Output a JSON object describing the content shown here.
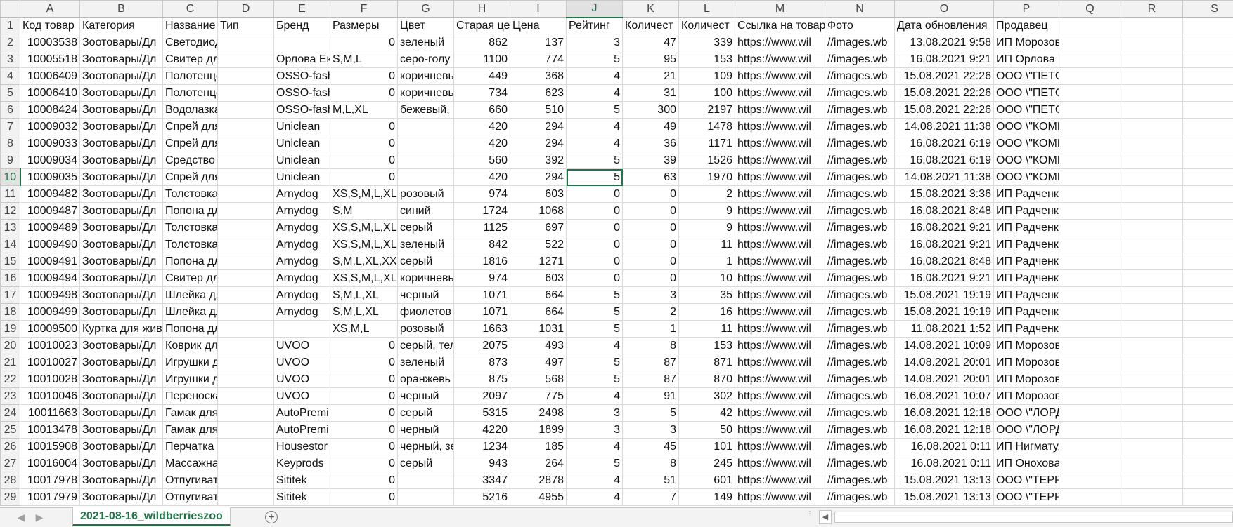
{
  "sheet": {
    "columns": [
      "A",
      "B",
      "C",
      "D",
      "E",
      "F",
      "G",
      "H",
      "I",
      "J",
      "K",
      "L",
      "M",
      "N",
      "O",
      "P",
      "Q",
      "R",
      "S"
    ],
    "headers": [
      "Код товар",
      "Категория",
      "Название",
      "Тип",
      "Бренд",
      "Размеры",
      "Цвет",
      "Старая це",
      "Цена",
      "Рейтинг",
      "Количест",
      "Количест",
      "Ссылка на товар",
      "Фото",
      "Дата обновления",
      "Продавец",
      "",
      "",
      ""
    ],
    "rows": [
      {
        "n": "2",
        "cells": [
          "10003538",
          "Зоотовары/Дл",
          "Светодиодный ошейник / Шле",
          "",
          "",
          "0",
          "зеленый",
          "862",
          "137",
          "3",
          "47",
          "339",
          "https://www.wil",
          "//images.wb",
          "13.08.2021 9:58",
          "ИП Морозов Андрей Васильевич",
          "",
          "",
          ""
        ]
      },
      {
        "n": "3",
        "cells": [
          "10005518",
          "Зоотовары/Дл",
          "Свитер для мелких п",
          "",
          "Орлова Ек",
          "S,M,L",
          "серо-голу",
          "1100",
          "774",
          "5",
          "95",
          "153",
          "https://www.wil",
          "//images.wb",
          "16.08.2021 9:21",
          "ИП Орлова Екатерина Александровна",
          "",
          "",
          ""
        ]
      },
      {
        "n": "4",
        "cells": [
          "10006409",
          "Зоотовары/Дл",
          "Полотенце для соба",
          "",
          "OSSO-fash",
          "0",
          "коричневы",
          "449",
          "368",
          "4",
          "21",
          "109",
          "https://www.wil",
          "//images.wb",
          "15.08.2021 22:26",
          "ООО \\\"ПЕТСОВЕТ\\\"",
          "",
          "",
          ""
        ]
      },
      {
        "n": "5",
        "cells": [
          "10006410",
          "Зоотовары/Дл",
          "Полотенце для живо",
          "",
          "OSSO-fash",
          "0",
          "коричневы",
          "734",
          "623",
          "4",
          "31",
          "100",
          "https://www.wil",
          "//images.wb",
          "15.08.2021 22:26",
          "ООО \\\"ПЕТСОВЕТ\\\"",
          "",
          "",
          ""
        ]
      },
      {
        "n": "6",
        "cells": [
          "10008424",
          "Зоотовары/Дл",
          "Водолазка для коше",
          "",
          "OSSO-fash",
          "M,L,XL",
          "бежевый,",
          "660",
          "510",
          "5",
          "300",
          "2197",
          "https://www.wil",
          "//images.wb",
          "15.08.2021 22:26",
          "ООО \\\"ПЕТСОВЕТ\\\"",
          "",
          "",
          ""
        ]
      },
      {
        "n": "7",
        "cells": [
          "10009032",
          "Зоотовары/Дл",
          "Спрей для удаления",
          "",
          "Uniclean",
          "0",
          "",
          "420",
          "294",
          "4",
          "49",
          "1478",
          "https://www.wil",
          "//images.wb",
          "14.08.2021 11:38",
          "ООО \\\"КОМПАНИЯ ЮНИКЛИН\\\"",
          "",
          "",
          ""
        ]
      },
      {
        "n": "8",
        "cells": [
          "10009033",
          "Зоотовары/Дл",
          "Спрей для удаления",
          "",
          "Uniclean",
          "0",
          "",
          "420",
          "294",
          "4",
          "36",
          "1171",
          "https://www.wil",
          "//images.wb",
          "16.08.2021 6:19",
          "ООО \\\"КОМПАНИЯ ЮНИКЛИН\\\"",
          "",
          "",
          ""
        ]
      },
      {
        "n": "9",
        "cells": [
          "10009034",
          "Зоотовары/Дл",
          "Средство для мытья",
          "",
          "Uniclean",
          "0",
          "",
          "560",
          "392",
          "5",
          "39",
          "1526",
          "https://www.wil",
          "//images.wb",
          "16.08.2021 6:19",
          "ООО \\\"КОМПАНИЯ ЮНИКЛИН\\\"",
          "",
          "",
          ""
        ]
      },
      {
        "n": "10",
        "cells": [
          "10009035",
          "Зоотовары/Дл",
          "Спрей для мытья ко",
          "",
          "Uniclean",
          "0",
          "",
          "420",
          "294",
          "5",
          "63",
          "1970",
          "https://www.wil",
          "//images.wb",
          "14.08.2021 11:38",
          "ООО \\\"КОМПАНИЯ ЮНИКЛИН\\\"",
          "",
          "",
          ""
        ]
      },
      {
        "n": "11",
        "cells": [
          "10009482",
          "Зоотовары/Дл",
          "Толстовка для соба",
          "",
          "Arnydog",
          "XS,S,M,L,XL",
          "розовый",
          "974",
          "603",
          "0",
          "0",
          "2",
          "https://www.wil",
          "//images.wb",
          "15.08.2021 3:36",
          "ИП Радченко Наталья Александровна",
          "",
          "",
          ""
        ]
      },
      {
        "n": "12",
        "cells": [
          "10009487",
          "Зоотовары/Дл",
          "Попона для собак \"/",
          "",
          "Arnydog",
          "S,M",
          "синий",
          "1724",
          "1068",
          "0",
          "0",
          "9",
          "https://www.wil",
          "//images.wb",
          "16.08.2021 8:48",
          "ИП Радченко Наталья Александровна",
          "",
          "",
          ""
        ]
      },
      {
        "n": "13",
        "cells": [
          "10009489",
          "Зоотовары/Дл",
          "Толстовка для соба",
          "",
          "Arnydog",
          "XS,S,M,L,XL",
          "серый",
          "1125",
          "697",
          "0",
          "0",
          "9",
          "https://www.wil",
          "//images.wb",
          "16.08.2021 9:21",
          "ИП Радченко Наталья Александровна",
          "",
          "",
          ""
        ]
      },
      {
        "n": "14",
        "cells": [
          "10009490",
          "Зоотовары/Дл",
          "Толстовка для соба",
          "",
          "Arnydog",
          "XS,S,M,L,XL",
          "зеленый",
          "842",
          "522",
          "0",
          "0",
          "11",
          "https://www.wil",
          "//images.wb",
          "16.08.2021 9:21",
          "ИП Радченко Наталья Александровна",
          "",
          "",
          ""
        ]
      },
      {
        "n": "15",
        "cells": [
          "10009491",
          "Зоотовары/Дл",
          "Попона для собак \"З",
          "",
          "Arnydog",
          "S,M,L,XL,XXL",
          "серый",
          "1816",
          "1271",
          "0",
          "0",
          "1",
          "https://www.wil",
          "//images.wb",
          "16.08.2021 8:48",
          "ИП Радченко Наталья Александровна",
          "",
          "",
          ""
        ]
      },
      {
        "n": "16",
        "cells": [
          "10009494",
          "Зоотовары/Дл",
          "Свитер для собак \"С",
          "",
          "Arnydog",
          "XS,S,M,L,XL,X",
          "коричневы",
          "974",
          "603",
          "0",
          "0",
          "10",
          "https://www.wil",
          "//images.wb",
          "16.08.2021 9:21",
          "ИП Радченко Наталья Александровна",
          "",
          "",
          ""
        ]
      },
      {
        "n": "17",
        "cells": [
          "10009498",
          "Зоотовары/Дл",
          "Шлейка для собак \"(",
          "",
          "Arnydog",
          "S,M,L,XL",
          "черный",
          "1071",
          "664",
          "5",
          "3",
          "35",
          "https://www.wil",
          "//images.wb",
          "15.08.2021 19:19",
          "ИП Радченко Наталья Александровна",
          "",
          "",
          ""
        ]
      },
      {
        "n": "18",
        "cells": [
          "10009499",
          "Зоотовары/Дл",
          "Шлейка для собак \"(",
          "",
          "Arnydog",
          "S,M,L,XL",
          "фиолетов",
          "1071",
          "664",
          "5",
          "2",
          "16",
          "https://www.wil",
          "//images.wb",
          "15.08.2021 19:19",
          "ИП Радченко Наталья Александровна",
          "",
          "",
          ""
        ]
      },
      {
        "n": "19",
        "cells": [
          "10009500",
          "Куртка для жив",
          "Попона для собак \"Star\" розов",
          "",
          "",
          "XS,M,L",
          "розовый",
          "1663",
          "1031",
          "5",
          "1",
          "11",
          "https://www.wil",
          "//images.wb",
          "11.08.2021 1:52",
          "ИП Радченко Наталья Александровна",
          "",
          "",
          ""
        ]
      },
      {
        "n": "20",
        "cells": [
          "10010023",
          "Зоотовары/Дл",
          "Коврик для животнь",
          "",
          "UVOO",
          "0",
          "серый, тел",
          "2075",
          "493",
          "4",
          "8",
          "153",
          "https://www.wil",
          "//images.wb",
          "14.08.2021 10:09",
          "ИП Морозов Андрей Васильевич",
          "",
          "",
          ""
        ]
      },
      {
        "n": "21",
        "cells": [
          "10010027",
          "Зоотовары/Дл",
          "Игрушки для кошек ,",
          "",
          "UVOO",
          "0",
          "зеленый",
          "873",
          "497",
          "5",
          "87",
          "871",
          "https://www.wil",
          "//images.wb",
          "14.08.2021 20:01",
          "ИП Морозов Андрей Васильевич",
          "",
          "",
          ""
        ]
      },
      {
        "n": "22",
        "cells": [
          "10010028",
          "Зоотовары/Дл",
          "Игрушки для кошек ,",
          "",
          "UVOO",
          "0",
          "оранжевь",
          "875",
          "568",
          "5",
          "87",
          "870",
          "https://www.wil",
          "//images.wb",
          "14.08.2021 20:01",
          "ИП Морозов Андрей Васильевич",
          "",
          "",
          ""
        ]
      },
      {
        "n": "23",
        "cells": [
          "10010046",
          "Зоотовары/Дл",
          "Переноска для живо",
          "",
          "UVOO",
          "0",
          "черный",
          "2097",
          "775",
          "4",
          "91",
          "302",
          "https://www.wil",
          "//images.wb",
          "16.08.2021 10:07",
          "ИП Морозов Андрей Васильевич",
          "",
          "",
          ""
        ]
      },
      {
        "n": "24",
        "cells": [
          "10011663",
          "Зоотовары/Дл",
          "Гамак для животны",
          "",
          "AutoPremi",
          "0",
          "серый",
          "5315",
          "2498",
          "3",
          "5",
          "42",
          "https://www.wil",
          "//images.wb",
          "16.08.2021 12:18",
          "ООО \\\"ЛОРД\\\"",
          "",
          "",
          ""
        ]
      },
      {
        "n": "25",
        "cells": [
          "10013478",
          "Зоотовары/Дл",
          "Гамак для животны",
          "",
          "AutoPremi",
          "0",
          "черный",
          "4220",
          "1899",
          "3",
          "3",
          "50",
          "https://www.wil",
          "//images.wb",
          "16.08.2021 12:18",
          "ООО \\\"ЛОРД\\\"",
          "",
          "",
          ""
        ]
      },
      {
        "n": "26",
        "cells": [
          "10015908",
          "Зоотовары/Дл",
          "Перчатка для вычес",
          "",
          "Housestor",
          "0",
          "черный, зе",
          "1234",
          "185",
          "4",
          "45",
          "101",
          "https://www.wil",
          "//images.wb",
          "16.08.2021 0:11",
          "ИП Нигматуллина Александра Олеговна",
          "",
          "",
          ""
        ]
      },
      {
        "n": "27",
        "cells": [
          "10016004",
          "Зоотовары/Дл",
          "Массажная рукавиц",
          "",
          "Keyprods",
          "0",
          "серый",
          "943",
          "264",
          "5",
          "8",
          "245",
          "https://www.wil",
          "//images.wb",
          "16.08.2021 0:11",
          "ИП Онохова Светлана Юрьевна",
          "",
          "",
          ""
        ]
      },
      {
        "n": "28",
        "cells": [
          "10017978",
          "Зоотовары/Дл",
          "Отпугиватель собак",
          "",
          "Sititek",
          "0",
          "",
          "3347",
          "2878",
          "4",
          "51",
          "601",
          "https://www.wil",
          "//images.wb",
          "15.08.2021 13:13",
          "ООО \\\"ТЕРРИТОРИЯ ЗДОРОВЬЯ\\\"",
          "",
          "",
          ""
        ]
      },
      {
        "n": "29",
        "cells": [
          "10017979",
          "Зоотовары/Дл",
          "Отпугиватель собак",
          "",
          "Sititek",
          "0",
          "",
          "5216",
          "4955",
          "4",
          "7",
          "149",
          "https://www.wil",
          "//images.wb",
          "15.08.2021 13:13",
          "ООО \\\"ТЕРРИТОРИЯ ЗДОРОВЬЯ\\\"",
          "",
          "",
          ""
        ]
      }
    ]
  },
  "selection": {
    "column": "J",
    "row": "10"
  },
  "tabs": {
    "sheet_name": "2021-08-16_wildberrieszoo",
    "add_symbol": "+",
    "prev_symbol": "◀",
    "next_symbol": "▶"
  },
  "colors": {
    "accent": "#217346",
    "grid": "#dadada",
    "header_bg": "#f2f2f2"
  }
}
